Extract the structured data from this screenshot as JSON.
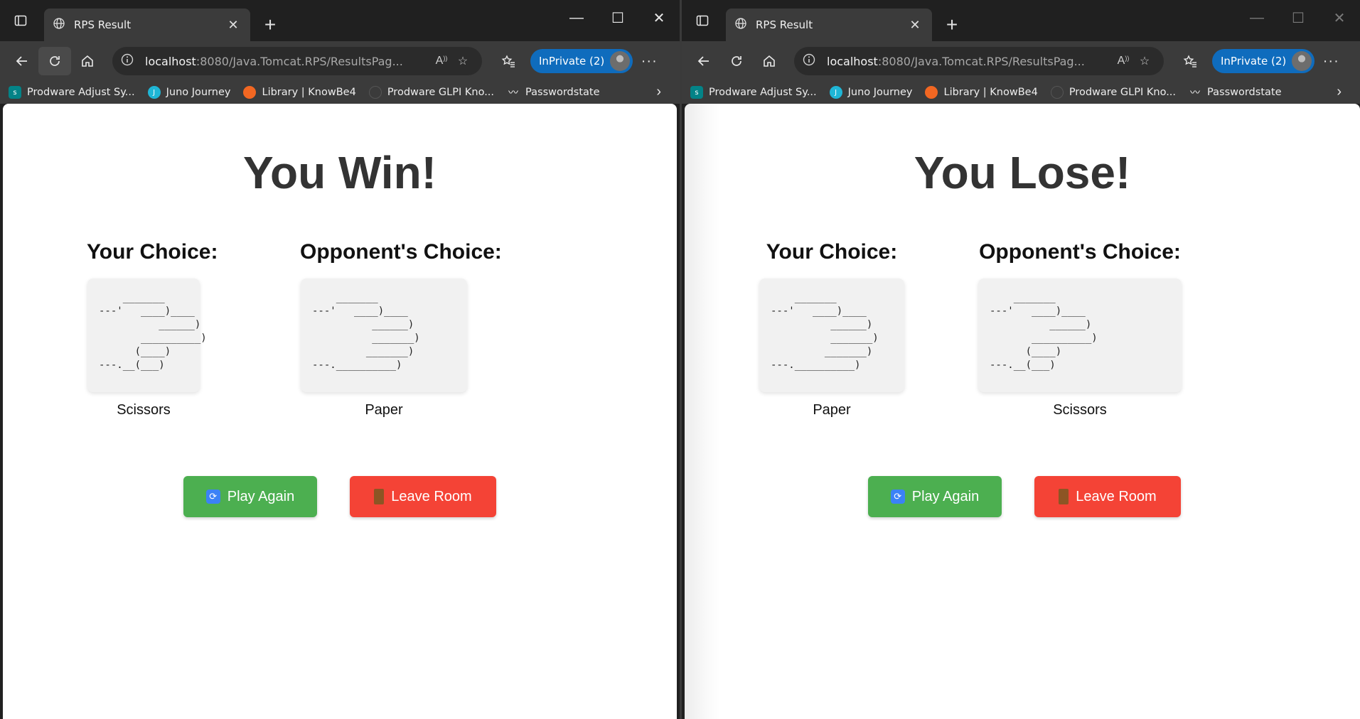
{
  "windows": [
    {
      "tab": {
        "title": "RPS Result"
      },
      "address": {
        "host": "localhost",
        "rest": ":8080/Java.Tomcat.RPS/ResultsPag..."
      },
      "inprivate": "InPrivate (2)",
      "bookmarks": [
        "Prodware Adjust Sy...",
        "Juno Journey",
        "Library | KnowBe4",
        "Prodware GLPI Kno...",
        "Passwordstate"
      ],
      "page": {
        "result": "You Win!",
        "your_label": "Your Choice:",
        "opp_label": "Opponent's Choice:",
        "your_choice": "Scissors",
        "opp_choice": "Paper",
        "your_art": "    _______\n---'   ____)____\n          ______)\n       __________)\n      (____)\n---.__(___)",
        "opp_art": "    _______\n---'   ____)____\n          ______)\n          _______)\n         _______)\n---.__________)",
        "play_again": "Play Again",
        "leave_room": "Leave Room"
      }
    },
    {
      "tab": {
        "title": "RPS Result"
      },
      "address": {
        "host": "localhost",
        "rest": ":8080/Java.Tomcat.RPS/ResultsPag..."
      },
      "inprivate": "InPrivate (2)",
      "bookmarks": [
        "Prodware Adjust Sy...",
        "Juno Journey",
        "Library | KnowBe4",
        "Prodware GLPI Kno...",
        "Passwordstate"
      ],
      "page": {
        "result": "You Lose!",
        "your_label": "Your Choice:",
        "opp_label": "Opponent's Choice:",
        "your_choice": "Paper",
        "opp_choice": "Scissors",
        "your_art": "    _______\n---'   ____)____\n          ______)\n          _______)\n         _______)\n---.__________)",
        "opp_art": "    _______\n---'   ____)____\n          ______)\n       __________)\n      (____)\n---.__(___)",
        "play_again": "Play Again",
        "leave_room": "Leave Room"
      }
    }
  ],
  "colors": {
    "play": "#4caf50",
    "leave": "#f44336",
    "inprivate": "#0f6cbd"
  },
  "icons": [
    "tab-actions-icon",
    "globe-icon",
    "close-icon",
    "new-tab-icon",
    "minimize-icon",
    "maximize-icon",
    "back-icon",
    "refresh-icon",
    "home-icon",
    "info-icon",
    "read-aloud-icon",
    "favorite-star-icon",
    "favorites-icon",
    "more-icon",
    "chevron-right-icon",
    "repeat-icon",
    "door-icon"
  ]
}
